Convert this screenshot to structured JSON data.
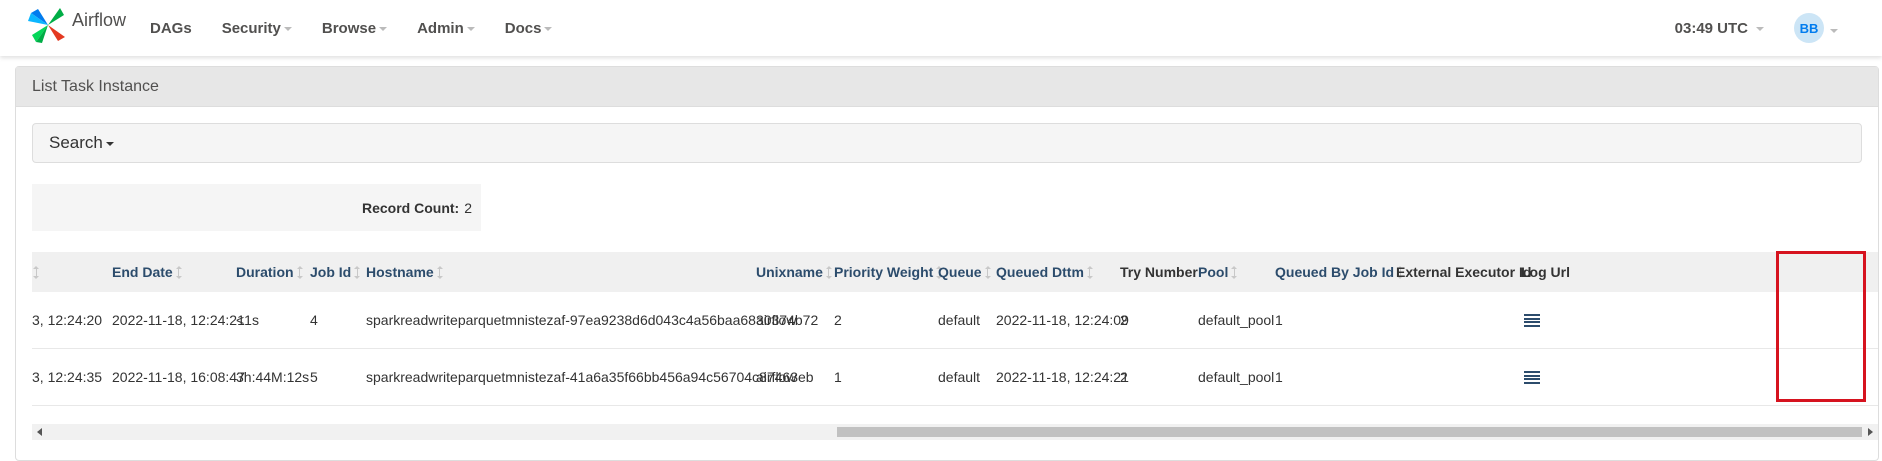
{
  "nav": {
    "brand": "Airflow",
    "menu": [
      "DAGs",
      "Security",
      "Browse",
      "Admin",
      "Docs"
    ],
    "clock": "03:49 UTC",
    "avatar": "BB"
  },
  "panel": {
    "title": "List Task Instance",
    "search_label": "Search",
    "record_count_label": "Record Count:",
    "record_count": "2"
  },
  "table": {
    "headers": {
      "end_date": "End Date",
      "duration": "Duration",
      "job_id": "Job Id",
      "hostname": "Hostname",
      "unixname": "Unixname",
      "priority_weight": "Priority Weight",
      "queue": "Queue",
      "queued_dttm": "Queued Dttm",
      "try_number": "Try Number",
      "pool": "Pool",
      "queued_by_job_id": "Queued By Job Id",
      "external_executor_id": "External Executor Id",
      "log_url": "Log Url"
    },
    "rows": [
      {
        "start_date": "3, 12:24:20",
        "end_date": "2022-11-18, 12:24:21",
        "duration": "<1s",
        "job_id": "4",
        "hostname": "sparkreadwriteparquetmnistezaf-97ea9238d6d043c4a56baa6830374b72",
        "unixname": "airflow",
        "priority_weight": "2",
        "queue": "default",
        "queued_dttm": "2022-11-18, 12:24:09",
        "try_number": "2",
        "pool": "default_pool",
        "queued_by_job_id": "1",
        "external_executor_id": ""
      },
      {
        "start_date": "3, 12:24:35",
        "end_date": "2022-11-18, 16:08:47",
        "duration": "3h:44M:12s",
        "job_id": "5",
        "hostname": "sparkreadwriteparquetmnistezaf-41a6a35f66bb456a94c56704c87463eb",
        "unixname": "airflow",
        "priority_weight": "1",
        "queue": "default",
        "queued_dttm": "2022-11-18, 12:24:21",
        "try_number": "2",
        "pool": "default_pool",
        "queued_by_job_id": "1",
        "external_executor_id": ""
      }
    ]
  },
  "icons": {
    "brand": "airflow-pinwheel-icon",
    "log": "list-lines-icon"
  },
  "colors": {
    "header_link": "#2c4c6c",
    "highlight": "#d6131f",
    "avatar_bg": "#cce5f6",
    "avatar_fg": "#017cee"
  }
}
